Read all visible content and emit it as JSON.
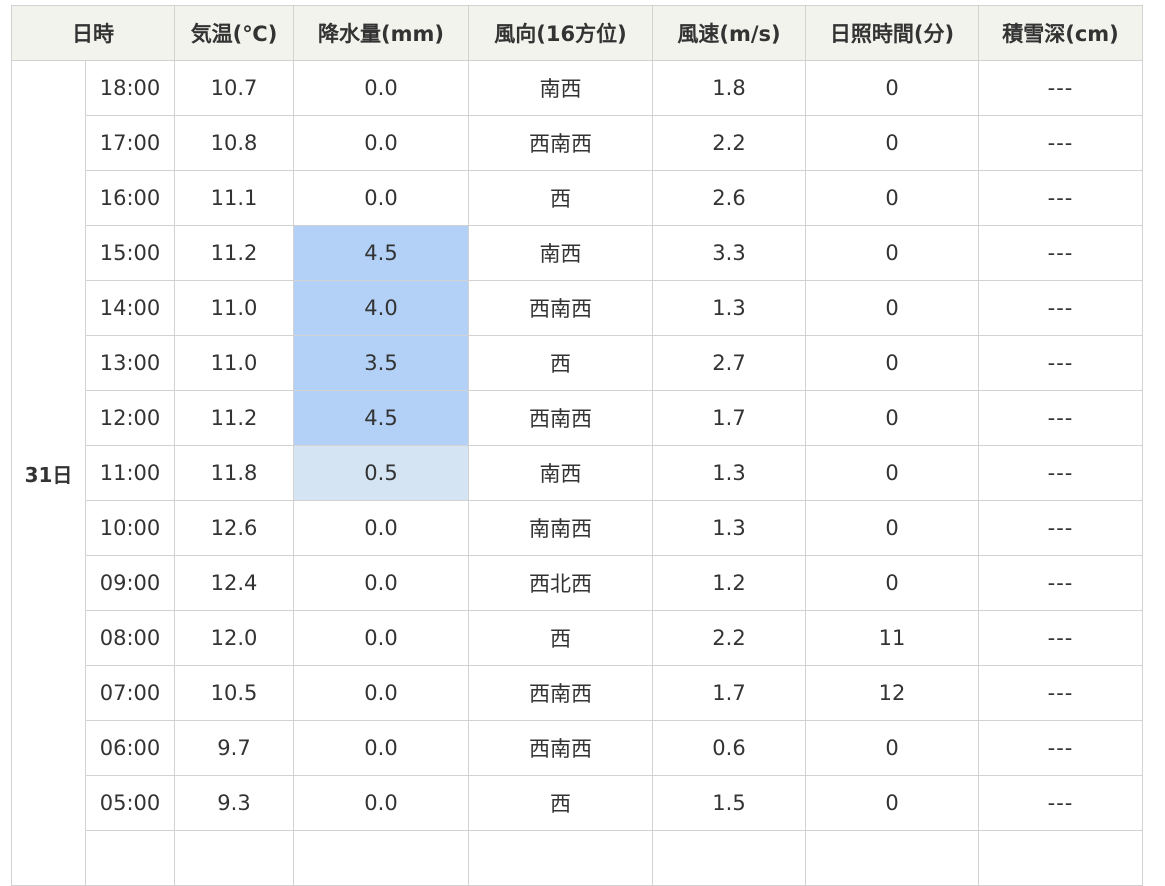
{
  "table": {
    "headers": [
      "日時",
      "気温(℃)",
      "降水量(mm)",
      "風向(16方位)",
      "風速(m/s)",
      "日照時間(分)",
      "積雪深(cm)"
    ],
    "day_label": "31日",
    "rows": [
      {
        "time": "18:00",
        "temp": "10.7",
        "precip": "0.0",
        "wind_dir": "南西",
        "wind_speed": "1.8",
        "sunshine": "0",
        "snow": "---"
      },
      {
        "time": "17:00",
        "temp": "10.8",
        "precip": "0.0",
        "wind_dir": "西南西",
        "wind_speed": "2.2",
        "sunshine": "0",
        "snow": "---"
      },
      {
        "time": "16:00",
        "temp": "11.1",
        "precip": "0.0",
        "wind_dir": "西",
        "wind_speed": "2.6",
        "sunshine": "0",
        "snow": "---"
      },
      {
        "time": "15:00",
        "temp": "11.2",
        "precip": "4.5",
        "wind_dir": "南西",
        "wind_speed": "3.3",
        "sunshine": "0",
        "snow": "---"
      },
      {
        "time": "14:00",
        "temp": "11.0",
        "precip": "4.0",
        "wind_dir": "西南西",
        "wind_speed": "1.3",
        "sunshine": "0",
        "snow": "---"
      },
      {
        "time": "13:00",
        "temp": "11.0",
        "precip": "3.5",
        "wind_dir": "西",
        "wind_speed": "2.7",
        "sunshine": "0",
        "snow": "---"
      },
      {
        "time": "12:00",
        "temp": "11.2",
        "precip": "4.5",
        "wind_dir": "西南西",
        "wind_speed": "1.7",
        "sunshine": "0",
        "snow": "---"
      },
      {
        "time": "11:00",
        "temp": "11.8",
        "precip": "0.5",
        "wind_dir": "南西",
        "wind_speed": "1.3",
        "sunshine": "0",
        "snow": "---"
      },
      {
        "time": "10:00",
        "temp": "12.6",
        "precip": "0.0",
        "wind_dir": "南南西",
        "wind_speed": "1.3",
        "sunshine": "0",
        "snow": "---"
      },
      {
        "time": "09:00",
        "temp": "12.4",
        "precip": "0.0",
        "wind_dir": "西北西",
        "wind_speed": "1.2",
        "sunshine": "0",
        "snow": "---"
      },
      {
        "time": "08:00",
        "temp": "12.0",
        "precip": "0.0",
        "wind_dir": "西",
        "wind_speed": "2.2",
        "sunshine": "11",
        "snow": "---"
      },
      {
        "time": "07:00",
        "temp": "10.5",
        "precip": "0.0",
        "wind_dir": "西南西",
        "wind_speed": "1.7",
        "sunshine": "12",
        "snow": "---"
      },
      {
        "time": "06:00",
        "temp": "9.7",
        "precip": "0.0",
        "wind_dir": "西南西",
        "wind_speed": "0.6",
        "sunshine": "0",
        "snow": "---"
      },
      {
        "time": "05:00",
        "temp": "9.3",
        "precip": "0.0",
        "wind_dir": "西",
        "wind_speed": "1.5",
        "sunshine": "0",
        "snow": "---"
      }
    ]
  },
  "colors": {
    "header_bg": "#f3f3ed",
    "border": "#d2d2d2",
    "text": "#333333",
    "precip_heavy": "#b3d1f7",
    "precip_light": "#d4e4f3"
  }
}
